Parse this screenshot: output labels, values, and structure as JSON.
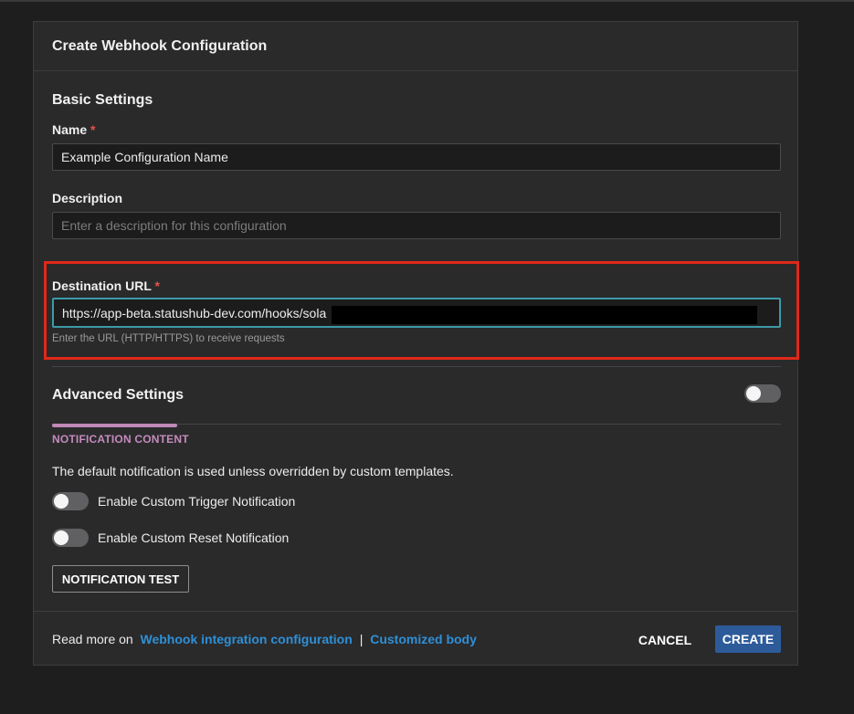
{
  "dialog": {
    "title": "Create Webhook Configuration"
  },
  "basic": {
    "section_title": "Basic Settings",
    "name_label": "Name",
    "name_value": "Example Configuration Name",
    "description_label": "Description",
    "description_placeholder": "Enter a description for this configuration",
    "required_marker": "*",
    "destination_label": "Destination URL",
    "destination_value": "https://app-beta.statushub-dev.com/hooks/sola",
    "destination_helper": "Enter the URL (HTTP/HTTPS) to receive requests"
  },
  "advanced": {
    "section_title": "Advanced Settings",
    "toggle_on": false
  },
  "notification": {
    "tab_label": "NOTIFICATION CONTENT",
    "description": "The default notification is used unless overridden by custom templates.",
    "trigger_label": "Enable Custom Trigger Notification",
    "trigger_on": false,
    "reset_label": "Enable Custom Reset Notification",
    "reset_on": false,
    "test_button": "NOTIFICATION TEST"
  },
  "footer": {
    "read_more": "Read more on",
    "link_integration": "Webhook integration configuration",
    "separator": "|",
    "link_body": "Customized body",
    "cancel_label": "CANCEL",
    "create_label": "CREATE"
  },
  "colors": {
    "accent_teal": "#3c9aa8",
    "highlight_red": "#e0281a",
    "tab_pink": "#c58bbd",
    "link_blue": "#2f8fd6",
    "primary_blue": "#2d5b9a",
    "required_red": "#e5534b"
  }
}
